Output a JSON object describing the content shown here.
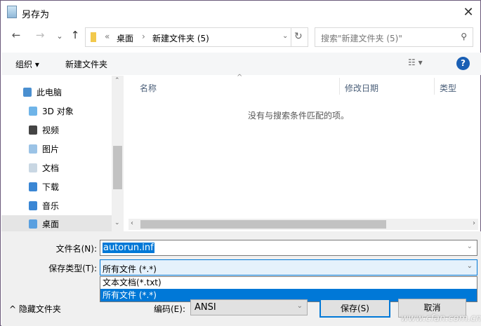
{
  "window": {
    "title": "另存为"
  },
  "nav": {
    "back": "←",
    "forward": "→",
    "recent": "⌄",
    "up": "↑"
  },
  "address": {
    "overflow": "«",
    "crumbs": [
      "桌面",
      "新建文件夹 (5)"
    ],
    "sep": "›"
  },
  "search": {
    "placeholder": "搜索\"新建文件夹 (5)\""
  },
  "toolbar": {
    "organize": "组织 ▾",
    "new_folder": "新建文件夹",
    "help": "?"
  },
  "sidebar": {
    "items": [
      {
        "label": "此电脑"
      },
      {
        "label": "3D 对象"
      },
      {
        "label": "视频"
      },
      {
        "label": "图片"
      },
      {
        "label": "文档"
      },
      {
        "label": "下载"
      },
      {
        "label": "音乐"
      },
      {
        "label": "桌面"
      }
    ]
  },
  "columns": {
    "name": "名称",
    "modified": "修改日期",
    "type": "类型"
  },
  "empty_message": "没有与搜索条件匹配的项。",
  "form": {
    "filename_label": "文件名(N):",
    "filename_value": "autorun.inf",
    "type_label": "保存类型(T):",
    "type_value": "所有文件  (*.*)",
    "type_options": [
      "文本文档(*.txt)",
      "所有文件  (*.*)"
    ],
    "encoding_label": "编码(E):",
    "encoding_value": "ANSI",
    "hide_folders": "隐藏文件夹",
    "save": "保存(S)",
    "cancel": "取消"
  },
  "watermark": "www.cfan.com.cn"
}
